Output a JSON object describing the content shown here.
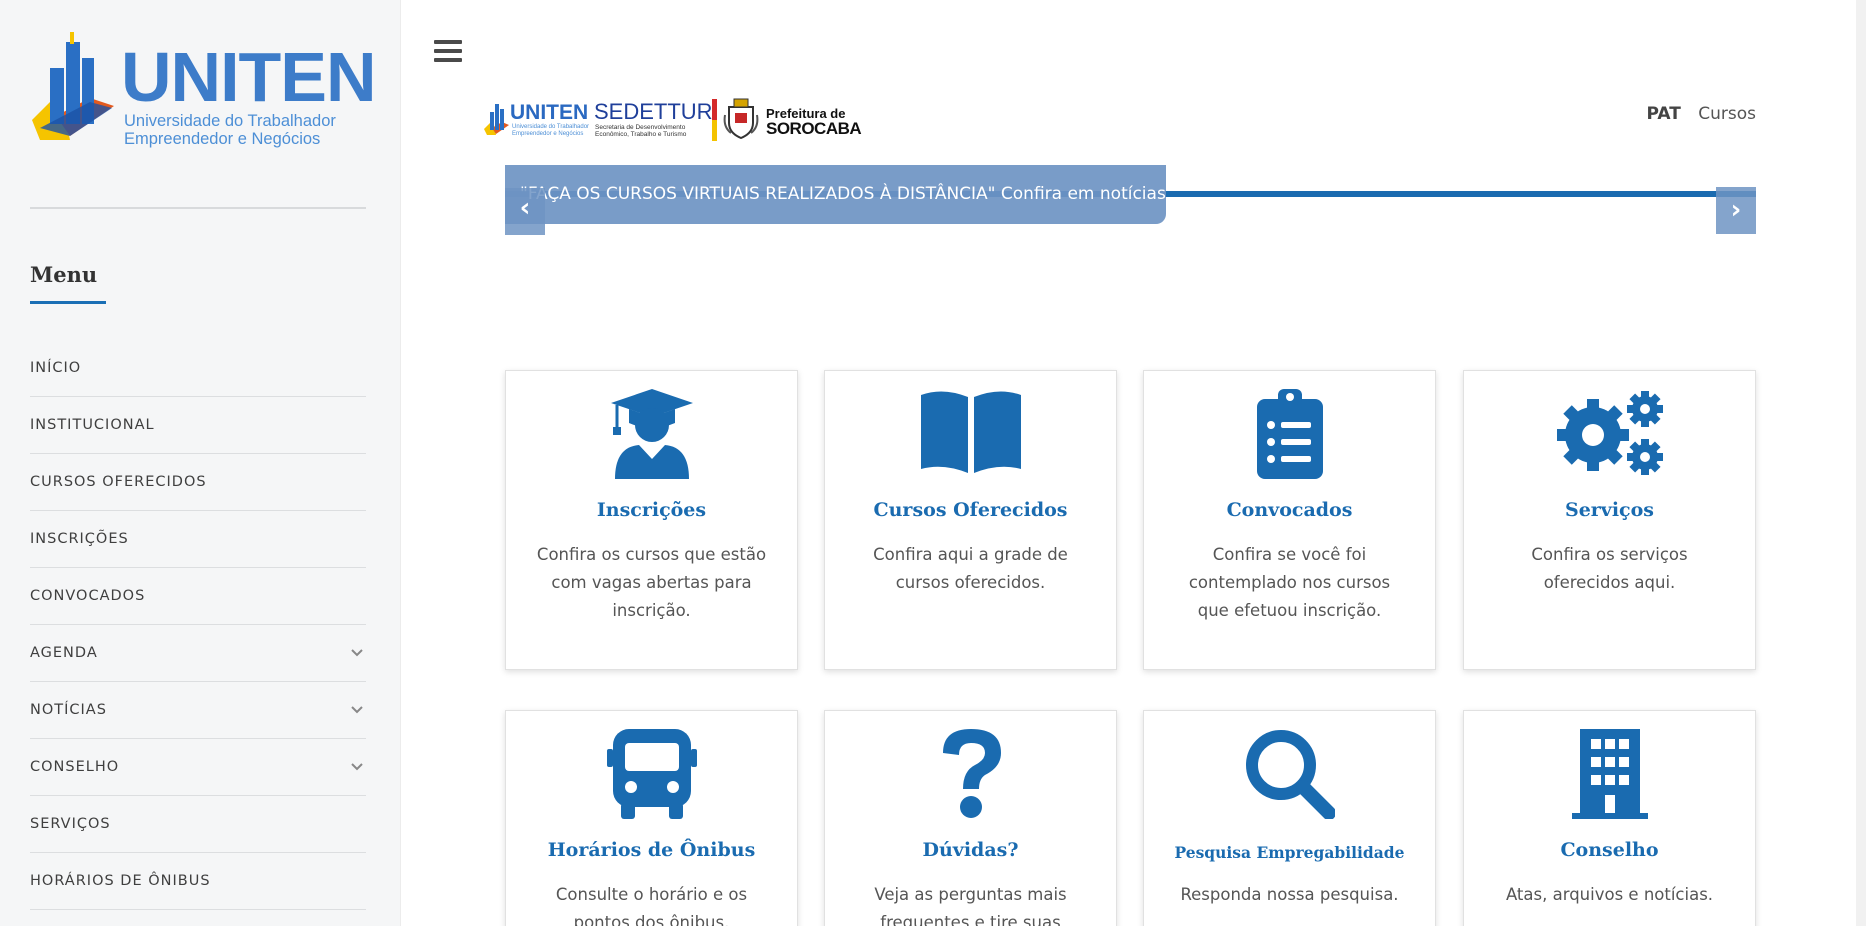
{
  "logo": {
    "title": "UNITEN",
    "subtitle_line1": "Universidade do Trabalhador",
    "subtitle_line2": "Empreendedor e Negócios"
  },
  "sidebar": {
    "menu_title": "Menu",
    "items": [
      {
        "label": "INÍCIO",
        "has_submenu": false
      },
      {
        "label": "INSTITUCIONAL",
        "has_submenu": false
      },
      {
        "label": "CURSOS OFERECIDOS",
        "has_submenu": false
      },
      {
        "label": "INSCRIÇÕES",
        "has_submenu": false
      },
      {
        "label": "CONVOCADOS",
        "has_submenu": false
      },
      {
        "label": "AGENDA",
        "has_submenu": true
      },
      {
        "label": "NOTÍCIAS",
        "has_submenu": true
      },
      {
        "label": "CONSELHO",
        "has_submenu": true
      },
      {
        "label": "SERVIÇOS",
        "has_submenu": false
      },
      {
        "label": "HORÁRIOS DE ÔNIBUS",
        "has_submenu": false
      }
    ]
  },
  "partners": {
    "uniten": "UNITEN",
    "uniten_sub1": "Universidade do Trabalhador",
    "uniten_sub2": "Empreendedor e Negócios",
    "sedettur": "SEDETTUR",
    "sedettur_sub1": "Secretaria de Desenvolvimento",
    "sedettur_sub2": "Econômico, Trabalho e Turismo",
    "prefeitura": "Prefeitura de",
    "sorocaba": "SOROCABA"
  },
  "topnav": {
    "items": [
      "PAT",
      "Cursos"
    ]
  },
  "slider": {
    "caption": "\"FAÇA OS CURSOS VIRTUAIS REALIZADOS À DISTÂNCIA\" Confira em notícias",
    "prev": "‹",
    "next": "›"
  },
  "cards": [
    {
      "icon": "graduate-icon",
      "title": "Inscrições",
      "text": "Confira os cursos que estão com vagas abertas para inscrição."
    },
    {
      "icon": "open-book-icon",
      "title": "Cursos Oferecidos",
      "text": "Confira aqui a grade de cursos oferecidos."
    },
    {
      "icon": "clipboard-list-icon",
      "title": "Convocados",
      "text": "Confira se você foi contemplado nos cursos que efetuou inscrição."
    },
    {
      "icon": "gears-icon",
      "title": "Serviços",
      "text": "Confira os serviços oferecidos aqui."
    },
    {
      "icon": "bus-icon",
      "title": "Horários de Ônibus",
      "text": "Consulte o horário e os pontos dos ônibus."
    },
    {
      "icon": "question-icon",
      "title": "Dúvidas?",
      "text": "Veja as perguntas mais frequentes e tire suas dúvidas."
    },
    {
      "icon": "search-icon",
      "title": "Pesquisa Empregabilidade",
      "text": "Responda nossa pesquisa."
    },
    {
      "icon": "building-icon",
      "title": "Conselho",
      "text": "Atas, arquivos e notícias."
    }
  ],
  "colors": {
    "accent": "#1a6bb0",
    "sidebar_bg": "#f5f6f7",
    "logo_blue": "#3d7cc9"
  }
}
